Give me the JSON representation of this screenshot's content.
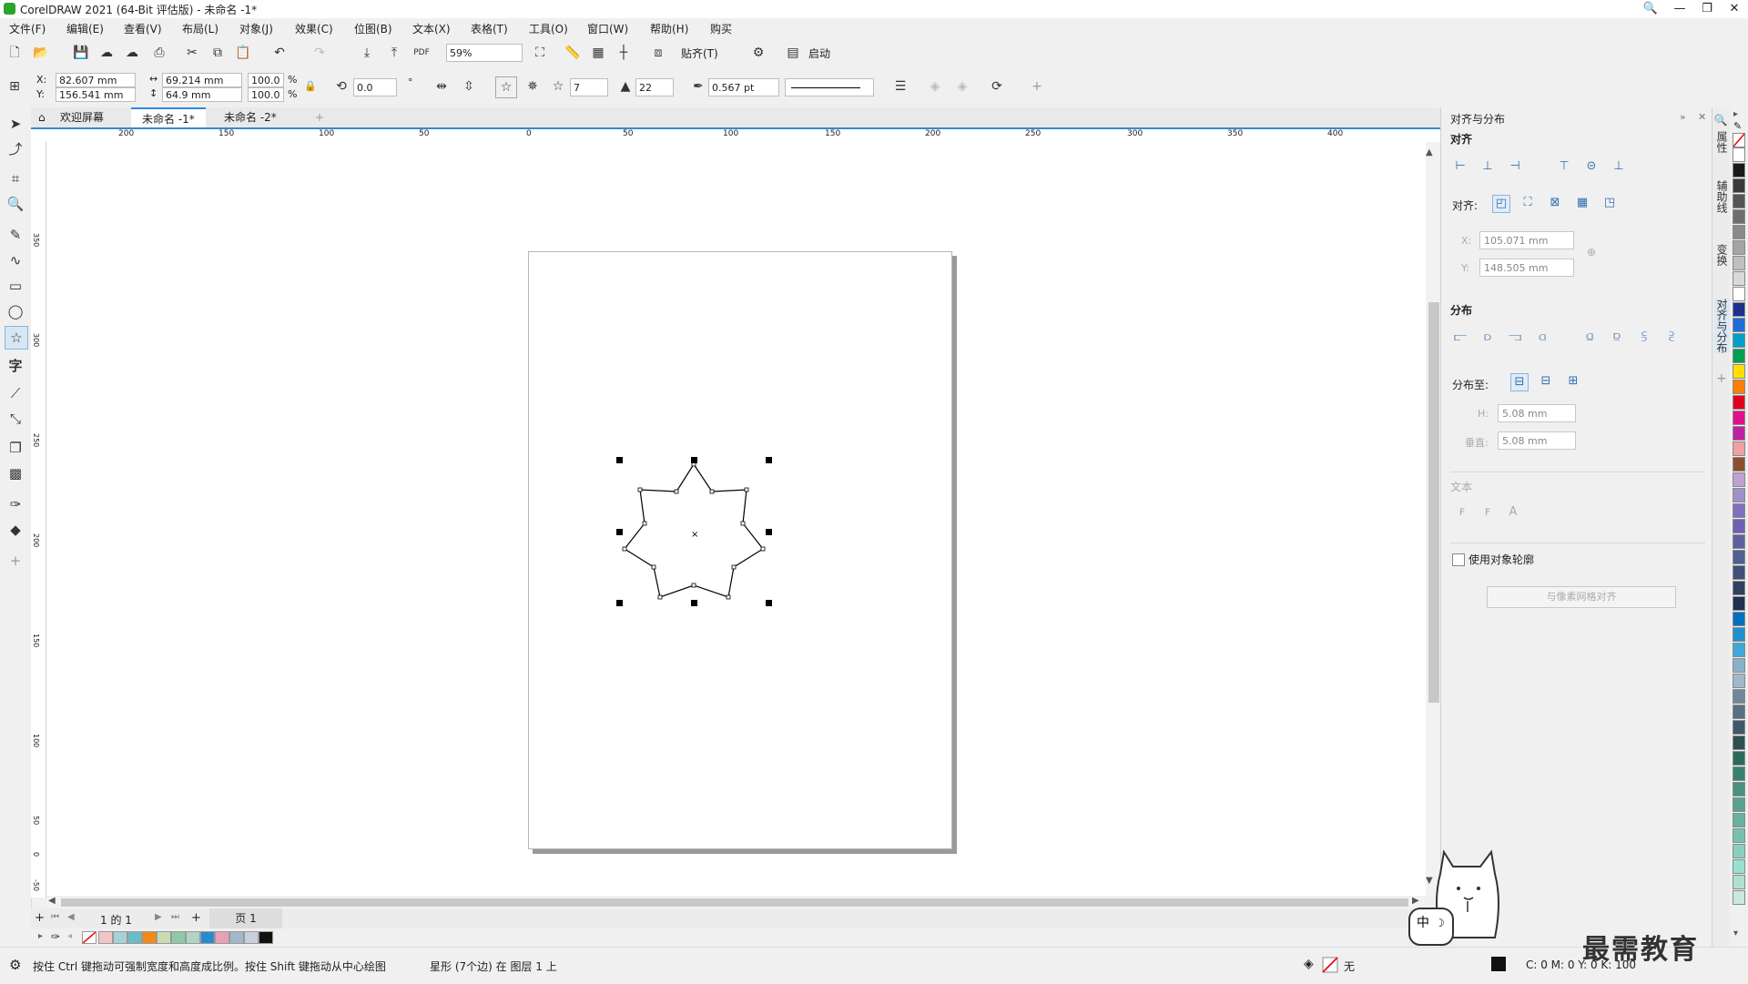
{
  "app": {
    "title": "CorelDRAW 2021 (64-Bit 评估版) - 未命名 -1*",
    "window_buttons": [
      "🔍",
      "—",
      "❐",
      "✕"
    ]
  },
  "menu": [
    "文件(F)",
    "编辑(E)",
    "查看(V)",
    "布局(L)",
    "对象(J)",
    "效果(C)",
    "位图(B)",
    "文本(X)",
    "表格(T)",
    "工具(O)",
    "窗口(W)",
    "帮助(H)",
    "购买"
  ],
  "toolbar": {
    "zoom": "59%",
    "snap_label": "贴齐(T)",
    "launch_label": "启动"
  },
  "propbar": {
    "x_label": "X:",
    "y_label": "Y:",
    "x_value": "82.607 mm",
    "y_value": "156.541 mm",
    "w_value": "69.214 mm",
    "h_value": "64.9 mm",
    "scale_w": "100.0",
    "scale_h": "100.0",
    "pct": "%",
    "rotation": "0.0",
    "deg": "°",
    "points": "7",
    "sharpness": "22",
    "outline_width": "0.567 pt"
  },
  "doc_tabs": [
    "欢迎屏幕",
    "未命名 -1*",
    "未命名 -2*"
  ],
  "ruler_h_ticks": [
    "200",
    "150",
    "100",
    "50",
    "0",
    "50",
    "100",
    "150",
    "200",
    "250",
    "300",
    "350",
    "400"
  ],
  "ruler_v_ticks": [
    "350",
    "300",
    "250",
    "200",
    "150",
    "100",
    "50",
    "0",
    "-50"
  ],
  "page_nav": {
    "counter": "1 的 1",
    "page_tab": "页 1"
  },
  "bottom_palette": [
    "#f2c6c6",
    "#a8d0d8",
    "#6cbcc8",
    "#f08a1c",
    "#c8dcb4",
    "#90c8a8",
    "#b0d4c8",
    "#2a8ad0",
    "#e8a0b8",
    "#a0b8c8",
    "#c8d0e0",
    "#111111"
  ],
  "status": {
    "hint": "按住 Ctrl 键拖动可强制宽度和高度成比例。按住 Shift 键拖动从中心绘图",
    "object": "星形 (7个边) 在 图层 1 上",
    "fill_none": "无",
    "cmyk": "C: 0 M: 0 Y: 0 K: 100"
  },
  "docker": {
    "title": "对齐与分布",
    "align_section": "对齐",
    "align_to_label": "对齐:",
    "x_label": "X:",
    "y_label": "Y:",
    "x_value": "105.071 mm",
    "y_value": "148.505 mm",
    "distribute_section": "分布",
    "distribute_to_label": "分布至:",
    "h_label": "H:",
    "v_label": "垂直:",
    "h_value": "5.08 mm",
    "v_value": "5.08 mm",
    "text_section": "文本",
    "use_outline_label": "使用对象轮廓",
    "align_grid_button": "与像素网格对齐"
  },
  "side_tabs": [
    "属性",
    "辅助线",
    "变换",
    "对齐与分布"
  ],
  "vertical_palette": [
    "#ffffff",
    "#1a1a1a",
    "#3a3a3a",
    "#555555",
    "#6e6e6e",
    "#8a8a8a",
    "#a4a4a4",
    "#bfbfbf",
    "#d9d9d9",
    "#ffffff",
    "#1f2f8c",
    "#1e6ed8",
    "#00a0c8",
    "#00a050",
    "#ffe000",
    "#ff8000",
    "#e00020",
    "#e0108c",
    "#c020a0",
    "#f0a0a0",
    "#8c5030",
    "#c0a0d0",
    "#a090c8",
    "#8070c0",
    "#7060b0",
    "#6060a0",
    "#506090",
    "#405078",
    "#304060",
    "#203050",
    "#0070c0",
    "#2090d0",
    "#40a8d8",
    "#8ab0c8",
    "#a0b8c8",
    "#708898",
    "#587080",
    "#405868",
    "#305050",
    "#2a6a5a",
    "#3a8070",
    "#4a9080",
    "#5aa090",
    "#6ab0a0",
    "#7ac0b0",
    "#8ad0c0",
    "#9ae0d0",
    "#b0e0d0",
    "#c8e8e0"
  ],
  "watermark": "最需教育",
  "mascot_text": "中",
  "star": {
    "points": 7
  }
}
